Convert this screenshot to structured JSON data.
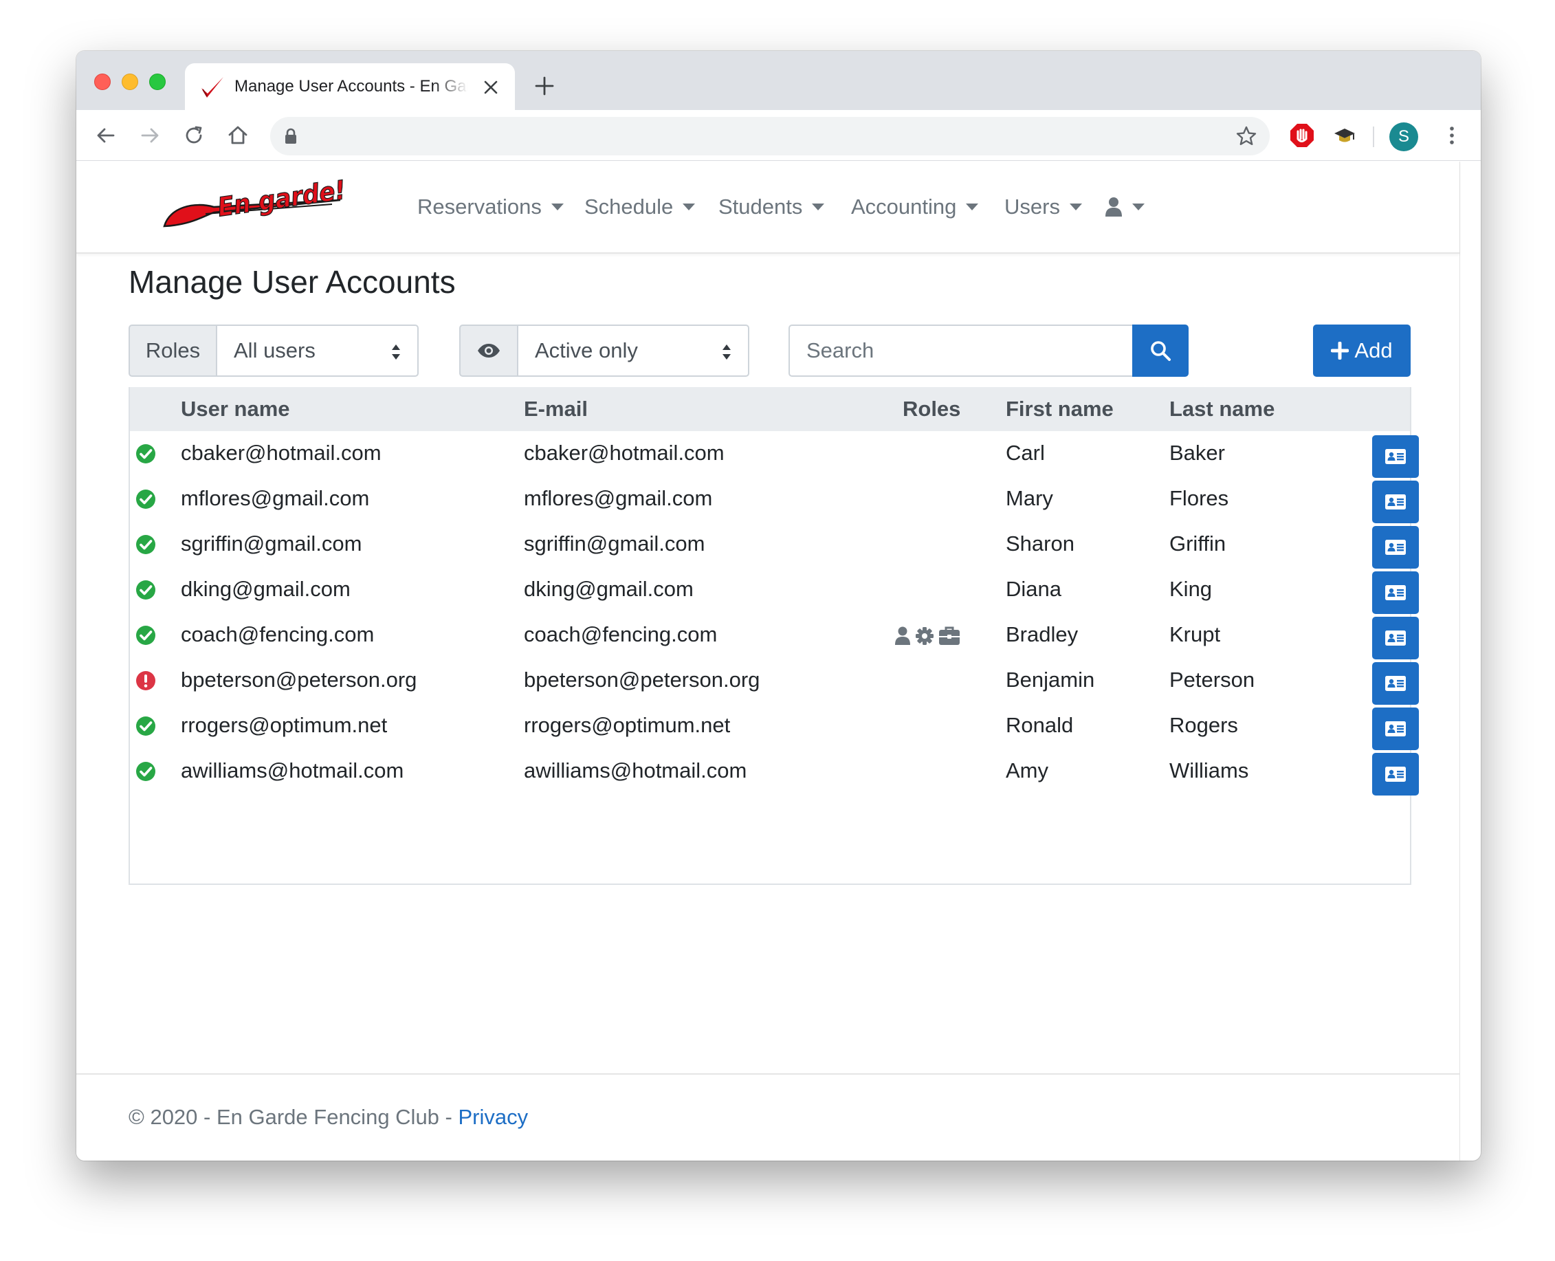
{
  "browser": {
    "tab_title": "Manage User Accounts - En Garde Fencing Club",
    "profile_initial": "S"
  },
  "brand": {
    "logo_text": "En garde!"
  },
  "nav": {
    "items": [
      {
        "label": "Reservations"
      },
      {
        "label": "Schedule"
      },
      {
        "label": "Students"
      },
      {
        "label": "Accounting"
      },
      {
        "label": "Users"
      }
    ]
  },
  "page": {
    "title": "Manage User Accounts"
  },
  "filters": {
    "roles_label": "Roles",
    "roles_value": "All users",
    "visibility_value": "Active only",
    "search_placeholder": "Search",
    "add_label": "Add"
  },
  "table": {
    "columns": {
      "username": "User name",
      "email": "E-mail",
      "roles": "Roles",
      "first_name": "First name",
      "last_name": "Last name"
    },
    "rows": [
      {
        "status": "ok",
        "username": "cbaker@hotmail.com",
        "email": "cbaker@hotmail.com",
        "roles": [],
        "first_name": "Carl",
        "last_name": "Baker"
      },
      {
        "status": "ok",
        "username": "mflores@gmail.com",
        "email": "mflores@gmail.com",
        "roles": [],
        "first_name": "Mary",
        "last_name": "Flores"
      },
      {
        "status": "ok",
        "username": "sgriffin@gmail.com",
        "email": "sgriffin@gmail.com",
        "roles": [],
        "first_name": "Sharon",
        "last_name": "Griffin"
      },
      {
        "status": "ok",
        "username": "dking@gmail.com",
        "email": "dking@gmail.com",
        "roles": [],
        "first_name": "Diana",
        "last_name": "King"
      },
      {
        "status": "ok",
        "username": "coach@fencing.com",
        "email": "coach@fencing.com",
        "roles": [
          "user-icon",
          "gear-icon",
          "briefcase-icon"
        ],
        "first_name": "Bradley",
        "last_name": "Krupt"
      },
      {
        "status": "error",
        "username": "bpeterson@peterson.org",
        "email": "bpeterson@peterson.org",
        "roles": [],
        "first_name": "Benjamin",
        "last_name": "Peterson"
      },
      {
        "status": "ok",
        "username": "rrogers@optimum.net",
        "email": "rrogers@optimum.net",
        "roles": [],
        "first_name": "Ronald",
        "last_name": "Rogers"
      },
      {
        "status": "ok",
        "username": "awilliams@hotmail.com",
        "email": "awilliams@hotmail.com",
        "roles": [],
        "first_name": "Amy",
        "last_name": "Williams"
      }
    ]
  },
  "footer": {
    "copyright": "© 2020 - En Garde Fencing Club - ",
    "privacy_link": "Privacy"
  },
  "colors": {
    "primary": "#1d6ec5",
    "status_ok": "#28a745",
    "status_error": "#dc3545",
    "nav_text": "#6c757d",
    "brand_red": "#e0101a"
  }
}
